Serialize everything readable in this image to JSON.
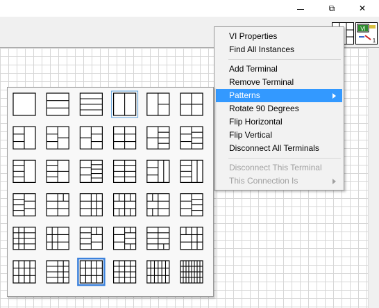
{
  "window": {
    "controls": [
      {
        "name": "minimize-button",
        "glyph": ""
      },
      {
        "name": "restore-button",
        "glyph": "⧉"
      },
      {
        "name": "close-button",
        "glyph": "✕"
      }
    ]
  },
  "context_menu": {
    "items": [
      {
        "label": "VI Properties",
        "enabled": true,
        "submenu": false
      },
      {
        "label": "Find All Instances",
        "enabled": true,
        "submenu": false
      },
      {
        "separator": true
      },
      {
        "label": "Add Terminal",
        "enabled": true,
        "submenu": false
      },
      {
        "label": "Remove Terminal",
        "enabled": true,
        "submenu": false
      },
      {
        "label": "Patterns",
        "enabled": true,
        "submenu": true,
        "highlighted": true
      },
      {
        "label": "Rotate 90 Degrees",
        "enabled": true,
        "submenu": false
      },
      {
        "label": "Flip Horizontal",
        "enabled": true,
        "submenu": false
      },
      {
        "label": "Flip Vertical",
        "enabled": true,
        "submenu": false
      },
      {
        "label": "Disconnect All Terminals",
        "enabled": true,
        "submenu": false
      },
      {
        "separator": true
      },
      {
        "label": "Disconnect This Terminal",
        "enabled": false,
        "submenu": false
      },
      {
        "label": "This Connection Is",
        "enabled": false,
        "submenu": true
      }
    ]
  },
  "vi_icon": {
    "label": "VI",
    "badge": "1"
  },
  "patterns": {
    "rows": 6,
    "cols": 6,
    "hover_index": 3,
    "selected_index": 32,
    "cells": [
      {
        "l": [],
        "r": []
      },
      {
        "l": [
          1,
          1,
          1
        ],
        "r": [
          1,
          1,
          1
        ]
      },
      {
        "l": [
          1,
          1,
          1,
          1
        ],
        "r": [
          1,
          1,
          1,
          1
        ]
      },
      {
        "l": [
          1
        ],
        "r": [
          1
        ]
      },
      {
        "l": [
          1
        ],
        "r": [
          1,
          1
        ]
      },
      {
        "l": [
          1,
          1
        ],
        "r": [
          1,
          1
        ]
      },
      {
        "l": [
          1,
          1,
          1
        ],
        "r": [
          1
        ]
      },
      {
        "l": [
          1,
          1,
          1
        ],
        "r": [
          1,
          1
        ]
      },
      {
        "l": [
          1,
          1
        ],
        "r": [
          1,
          1,
          1
        ]
      },
      {
        "l": [
          1,
          1,
          1
        ],
        "r": [
          1,
          1,
          1
        ]
      },
      {
        "l": [
          1,
          1
        ],
        "r": [
          1,
          1,
          1,
          1
        ]
      },
      {
        "l": [
          1,
          1,
          1
        ],
        "r": [
          1,
          1,
          1,
          1
        ]
      },
      {
        "l": [
          1,
          1,
          1,
          1
        ],
        "r": [
          1
        ]
      },
      {
        "l": [
          1,
          1,
          1,
          1
        ],
        "r": [
          1,
          1
        ]
      },
      {
        "l": [
          1,
          1,
          1
        ],
        "r": [
          1,
          1,
          1,
          1,
          1
        ]
      },
      {
        "l": [
          1,
          1,
          1,
          1
        ],
        "r": [
          1,
          1,
          1,
          1
        ]
      },
      {
        "l": [
          1,
          1,
          1
        ],
        "r": [
          2
        ]
      },
      {
        "l": [
          1,
          1,
          1,
          1
        ],
        "r": [
          2
        ]
      },
      {
        "l": [
          1,
          1,
          1,
          1
        ],
        "r": [
          1,
          1,
          1
        ]
      },
      {
        "l": [
          1,
          1,
          1
        ],
        "r": [
          2,
          1,
          1
        ]
      },
      {
        "l": [
          1,
          1,
          1
        ],
        "r": [
          2,
          2,
          2
        ]
      },
      {
        "l": [
          2,
          1,
          2
        ],
        "r": [
          2,
          1,
          2
        ]
      },
      {
        "l": [
          2,
          1,
          2
        ],
        "r": [
          1,
          1,
          1
        ]
      },
      {
        "l": [
          1,
          1,
          1
        ],
        "r": [
          1,
          1,
          1,
          1
        ]
      },
      {
        "l": [
          2,
          2,
          2,
          2
        ],
        "r": [
          1,
          1,
          1,
          1
        ]
      },
      {
        "l": [
          2,
          2,
          2
        ],
        "r": [
          1,
          1,
          1
        ]
      },
      {
        "l": [
          1,
          1,
          1,
          1
        ],
        "r": [
          2,
          1,
          1
        ]
      },
      {
        "l": [
          1,
          1,
          1
        ],
        "r": [
          2,
          1,
          1,
          2
        ]
      },
      {
        "l": [
          1,
          1,
          1,
          1
        ],
        "r": [
          1,
          1,
          1,
          2
        ]
      },
      {
        "l": [
          2,
          1,
          1
        ],
        "r": [
          2,
          2,
          2
        ]
      },
      {
        "l": [
          2,
          2,
          2
        ],
        "r": [
          2,
          2,
          2
        ]
      },
      {
        "l": [
          1,
          1,
          1,
          1
        ],
        "r": [
          2,
          2,
          2,
          2
        ]
      },
      {
        "l": [
          2,
          2,
          2
        ],
        "r": [
          2,
          2,
          2
        ]
      },
      {
        "l": [
          2,
          2,
          2,
          2
        ],
        "r": [
          2,
          2,
          2,
          2
        ]
      },
      {
        "l": [
          3,
          3,
          3
        ],
        "r": [
          3,
          3,
          3
        ]
      },
      {
        "l": [
          4,
          4,
          4,
          4
        ],
        "r": [
          4,
          4,
          4,
          4
        ]
      }
    ]
  }
}
